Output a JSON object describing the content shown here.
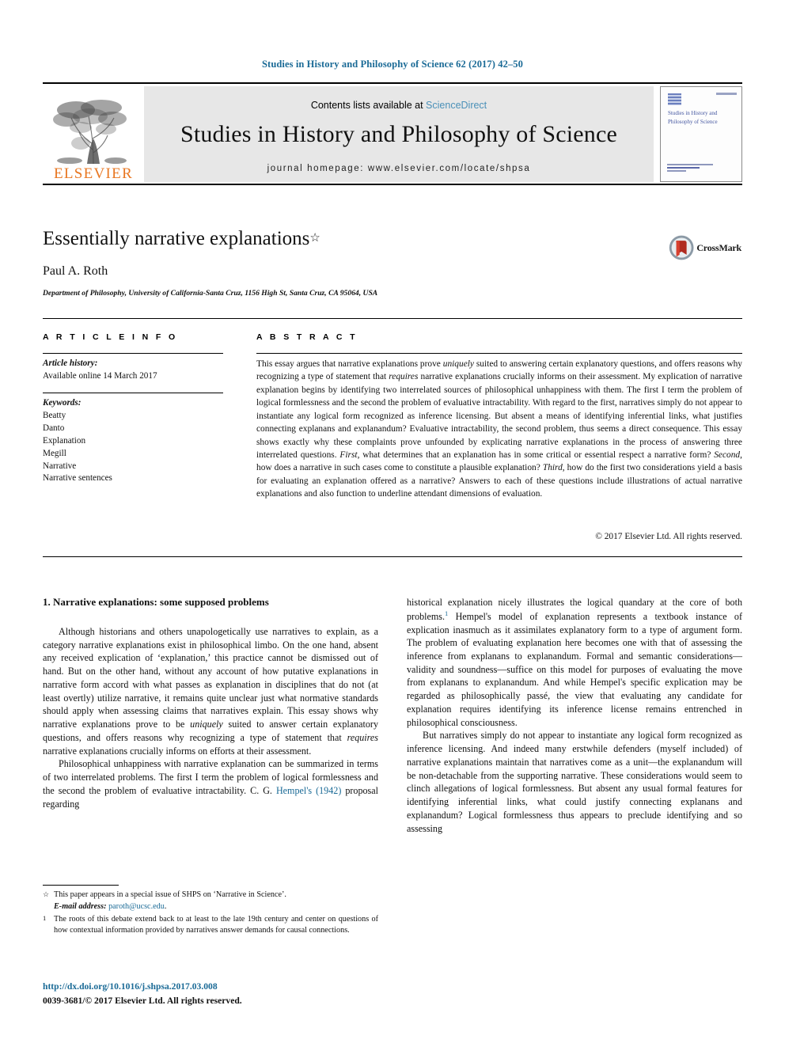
{
  "running_head": "Studies in History and Philosophy of Science 62 (2017) 42–50",
  "masthead": {
    "contents_prefix": "Contents lists available at ",
    "sciencedirect_link": "ScienceDirect",
    "journal_title": "Studies in History and Philosophy of Science",
    "homepage_line": "journal homepage: www.elsevier.com/locate/shpsa",
    "publisher_wordmark": "ELSEVIER",
    "cover_title": "Studies in History and Philosophy of Science",
    "link_color": "#4a90b8",
    "wordmark_color": "#e87722",
    "band_color": "#e7e7e7"
  },
  "article": {
    "title": "Essentially narrative explanations",
    "title_footnote_marker": "☆",
    "author": "Paul A. Roth",
    "affiliation": "Department of Philosophy, University of California-Santa Cruz, 1156 High St, Santa Cruz, CA 95064, USA",
    "crossmark_label": "CrossMark"
  },
  "article_info": {
    "heading": "A R T I C L E  I N F O",
    "history_label": "Article history:",
    "history_value": "Available online 14 March 2017",
    "keywords_label": "Keywords:",
    "keywords": [
      "Beatty",
      "Danto",
      "Explanation",
      "Megill",
      "Narrative",
      "Narrative sentences"
    ]
  },
  "abstract": {
    "heading": "A B S T R A C T",
    "paragraph_html": "This essay argues that narrative explanations prove <em>uniquely</em> suited to answering certain explanatory questions, and offers reasons why recognizing a type of statement that <em>requires</em> narrative explanations crucially informs on their assessment. My explication of narrative explanation begins by identifying two interrelated sources of philosophical unhappiness with them. The first I term the problem of logical formlessness and the second the problem of evaluative intractability. With regard to the first, narratives simply do not appear to instantiate any logical form recognized as inference licensing. But absent a means of identifying inferential links, what justifies connecting explanans and explanandum? Evaluative intractability, the second problem, thus seems a direct consequence. This essay shows exactly why these complaints prove unfounded by explicating narrative explanations in the process of answering three interrelated questions. <em>First</em>, what determines that an explanation has in some critical or essential respect a narrative form? <em>Second</em>, how does a narrative in such cases come to constitute a plausible explanation? <em>Third</em>, how do the first two considerations yield a basis for evaluating an explanation offered as a narrative? Answers to each of these questions include illustrations of actual narrative explanations and also function to underline attendant dimensions of evaluation.",
    "copyright": "© 2017 Elsevier Ltd. All rights reserved."
  },
  "body": {
    "section_heading": "1. Narrative explanations: some supposed problems",
    "left_column_html": [
      "Although historians and others unapologetically use narratives to explain, as a category narrative explanations exist in philosophical limbo. On the one hand, absent any received explication of ‘explanation,’ this practice cannot be dismissed out of hand. But on the other hand, without any account of how putative explanations in narrative form accord with what passes as explanation in disciplines that do not (at least overtly) utilize narrative, it remains quite unclear just what normative standards should apply when assessing claims that narratives explain. This essay shows why narrative explanations prove to be <em>uniquely</em> suited to answer certain explanatory questions, and offers reasons why recognizing a type of statement that <em>requires</em> narrative explanations crucially informs on efforts at their assessment.",
      "Philosophical unhappiness with narrative explanation can be summarized in terms of two interrelated problems. The first I term the problem of logical formlessness and the second the problem of evaluative intractability. C. G. <span class=\"ref-link\" data-name=\"citation-link-hempel\" data-interactable=\"true\">Hempel's (1942)</span> proposal regarding"
    ],
    "right_column_html": [
      "historical explanation nicely illustrates the logical quandary at the core of both problems.<sup class=\"fn-ref\" data-name=\"footnote-reference-1\" data-interactable=\"true\">1</sup> Hempel's model of explanation represents a textbook instance of explication inasmuch as it assimilates explanatory form to a type of argument form. The problem of evaluating explanation here becomes one with that of assessing the inference from explanans to explanandum. Formal and semantic considerations—validity and soundness—suffice on this model for purposes of evaluating the move from explanans to explanandum. And while Hempel's specific explication may be regarded as philosophically passé, the view that evaluating any candidate for explanation requires identifying its inference license remains entrenched in philosophical consciousness.",
      "But narratives simply do not appear to instantiate any logical form recognized as inference licensing. And indeed many erstwhile defenders (myself included) of narrative explanations maintain that narratives come as a unit—the explanandum will be non-detachable from the supporting narrative. These considerations would seem to clinch allegations of logical formlessness. But absent any usual formal features for identifying inferential links, what could justify connecting explanans and explanandum? Logical formlessness thus appears to preclude identifying and so assessing"
    ]
  },
  "footnotes": {
    "star_marker": "☆",
    "star_text": "This paper appears in a special issue of SHPS on ‘Narrative in Science’.",
    "email_label": "E-mail address:",
    "email": "paroth@ucsc.edu",
    "num_marker": "1",
    "num_text": "The roots of this debate extend back to at least to the late 19th century and center on questions of how contextual information provided by narratives answer demands for causal connections."
  },
  "footer": {
    "doi": "http://dx.doi.org/10.1016/j.shpsa.2017.03.008",
    "issn_line": "0039-3681/© 2017 Elsevier Ltd. All rights reserved.",
    "link_color": "#1a6a96"
  }
}
